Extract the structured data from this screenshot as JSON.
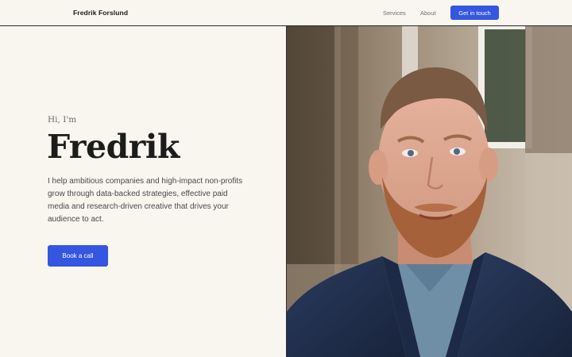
{
  "header": {
    "brand": "Fredrik Forslund",
    "nav": {
      "services": "Services",
      "about": "About"
    },
    "cta": "Get in touch"
  },
  "hero": {
    "greeting": "Hi, I'm",
    "name": "Fredrik",
    "description": "I help ambitious companies and high-impact non-profits grow through data-backed strategies, effective paid media and research-driven creative that drives your audience to act.",
    "cta": "Book a call"
  },
  "colors": {
    "background": "#f9f5ef",
    "accent": "#3456e0",
    "text": "#1c1c1c"
  }
}
